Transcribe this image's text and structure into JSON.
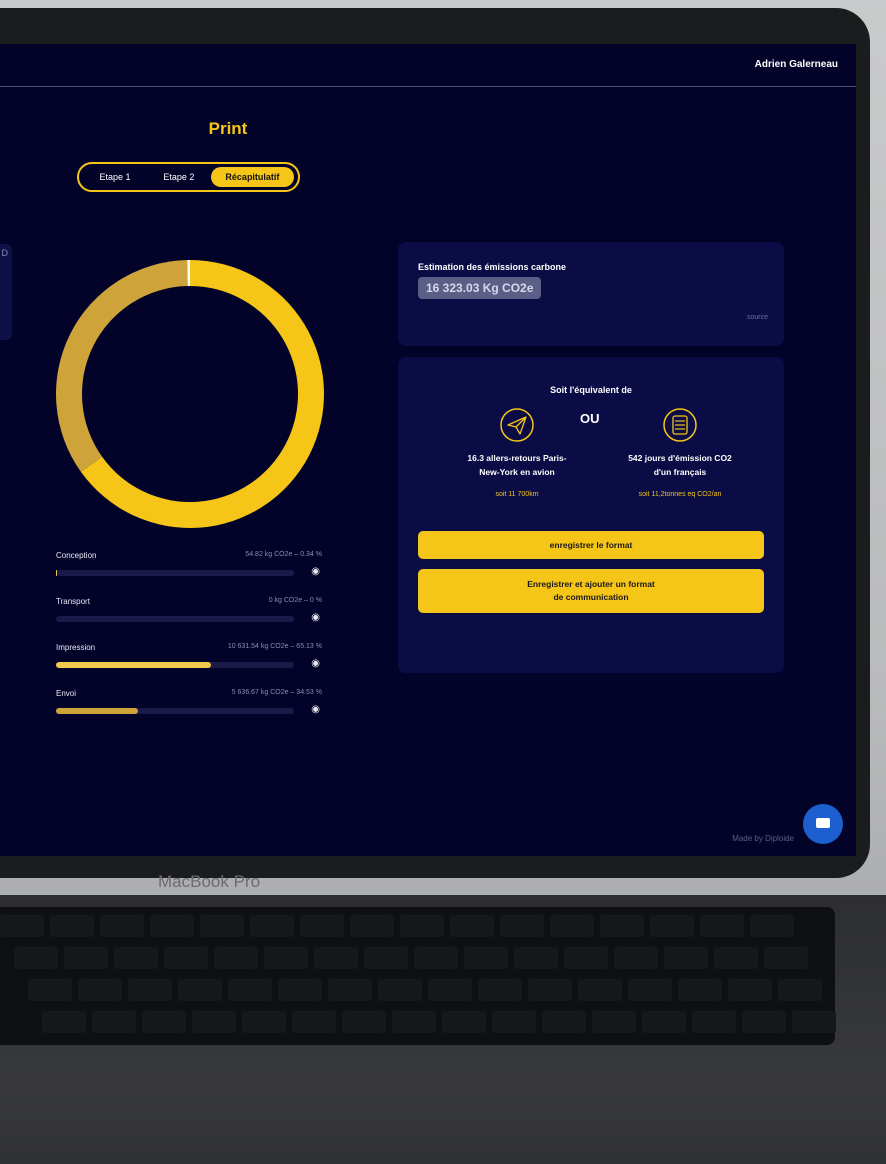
{
  "header": {
    "user_name": "Adrien Galerneau"
  },
  "page": {
    "title": "Print",
    "left_card_label": "D"
  },
  "steps": [
    {
      "label": "Etape 1",
      "active": false
    },
    {
      "label": "Etape 2",
      "active": false
    },
    {
      "label": "Récapitulatif",
      "active": true
    }
  ],
  "donut": {
    "segments": [
      {
        "name": "Impression",
        "percent": 65.13,
        "color": "#f5c518"
      },
      {
        "name": "Envoi",
        "percent": 34.53,
        "color": "#cda33a"
      },
      {
        "name": "Conception",
        "percent": 0.34,
        "color": "#ffffff"
      }
    ]
  },
  "breakdown": [
    {
      "label": "Conception",
      "value": "54.82 kg CO2e – 0.34 %",
      "percent": 0.34
    },
    {
      "label": "Transport",
      "value": "0 kg CO2e – 0 %",
      "percent": 0
    },
    {
      "label": "Impression",
      "value": "10 631.54 kg CO2e – 65.13 %",
      "percent": 65.13
    },
    {
      "label": "Envoi",
      "value": "5 636.67 kg CO2e – 34.53 %",
      "percent": 34.53
    }
  ],
  "estimate": {
    "title": "Estimation des émissions carbone",
    "value": "16 323.03 Kg CO2e",
    "tag": "source"
  },
  "equivalent": {
    "title": "Soit l'équivalent de",
    "or": "OU",
    "left": {
      "icon": "paper-plane-icon",
      "line1": "16.3 allers-retours Paris-",
      "line2": "New-York en avion",
      "sub": "soit 11 700km"
    },
    "right": {
      "icon": "person-icon",
      "line1": "542 jours d'émission CO2",
      "line2": "d'un français",
      "sub": "soit 11,2tonnes eq CO2/an"
    }
  },
  "buttons": {
    "save_format": "enregistrer le format",
    "save_add_line1": "Enregistrer et ajouter un format",
    "save_add_line2": "de communication"
  },
  "footer": {
    "credit": "Made by Diploide"
  },
  "device": {
    "brand": "MacBook Pro"
  },
  "colors": {
    "accent": "#f5c518",
    "background": "#03032a",
    "card": "#0b0c45"
  }
}
